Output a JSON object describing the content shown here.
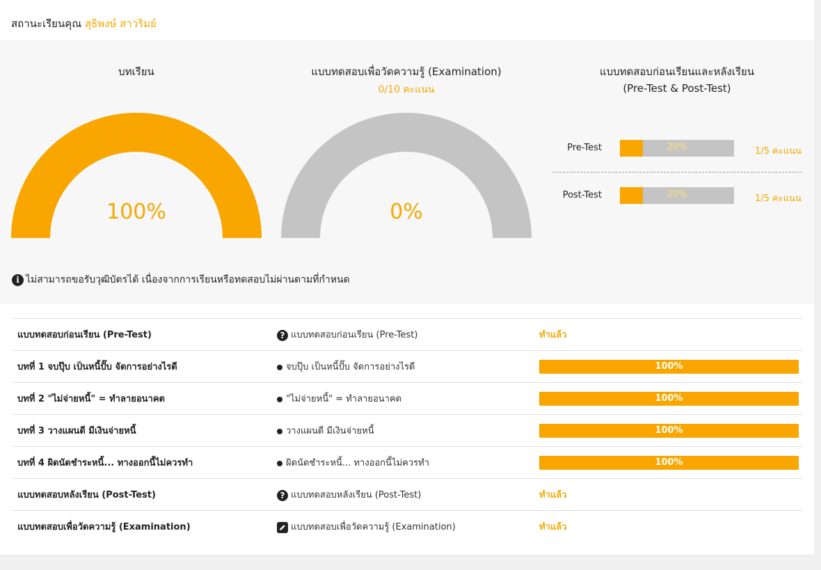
{
  "header": {
    "prefix": "สถานะเรียนคุณ",
    "name": "สุธิพงษ์ สาวริมย์"
  },
  "summary": {
    "lessons": {
      "title": "บทเรียน",
      "percent_label": "100%",
      "percent": 100
    },
    "exam": {
      "title": "แบบทดสอบเพื่อวัดความรู้ (Examination)",
      "score": "0/10 คะแนน",
      "percent_label": "0%",
      "percent": 0
    },
    "prepost": {
      "title_line1": "แบบทดสอบก่อนเรียนและหลังเรียน",
      "title_line2": "(Pre-Test & Post-Test)",
      "pre": {
        "label": "Pre-Test",
        "bar_label": "20%",
        "percent": 20,
        "score": "1/5 คะแนน"
      },
      "post": {
        "label": "Post-Test",
        "bar_label": "20%",
        "percent": 20,
        "score": "1/5 คะแนน"
      }
    },
    "notice": "ไม่สามารถขอรับวุฒิบัตรได้ เนื่องจากการเรียนหรือทดสอบไม่ผ่านตามที่กำหนด"
  },
  "colors": {
    "accent": "#f9a600",
    "gauge_empty": "#c4c4c4"
  },
  "rows": [
    {
      "title": "แบบทดสอบก่อนเรียน (Pre-Test)",
      "item_icon": "question-circle-icon",
      "item": "แบบทดสอบก่อนเรียน (Pre-Test)",
      "status": "ทำแล้ว"
    },
    {
      "title": "บทที่ 1 จบปุ๊บ เป็นหนี้ปั๊บ จัดการอย่างไรดี",
      "item_icon": "bullet-icon",
      "item": "จบปุ๊บ เป็นหนี้ปั๊บ จัดการอย่างไรดี",
      "progress": "100%"
    },
    {
      "title": "บทที่ 2 \"ไม่จ่ายหนี้\" = ทำลายอนาคต",
      "item_icon": "bullet-icon",
      "item": "\"ไม่จ่ายหนี้\" = ทำลายอนาคต",
      "progress": "100%"
    },
    {
      "title": "บทที่ 3 วางแผนดี มีเงินจ่ายหนี้",
      "item_icon": "bullet-icon",
      "item": "วางแผนดี มีเงินจ่ายหนี้",
      "progress": "100%"
    },
    {
      "title": "บทที่ 4 ผิดนัดชำระหนี้... ทางออกนี้ไม่ควรทำ",
      "item_icon": "bullet-icon",
      "item": "ผิดนัดชำระหนี้... ทางออกนี้ไม่ควรทำ",
      "progress": "100%"
    },
    {
      "title": "แบบทดสอบหลังเรียน (Post-Test)",
      "item_icon": "question-circle-icon",
      "item": "แบบทดสอบหลังเรียน (Post-Test)",
      "status": "ทำแล้ว"
    },
    {
      "title": "แบบทดสอบเพื่อวัดความรู้ (Examination)",
      "item_icon": "edit-icon",
      "item": "แบบทดสอบเพื่อวัดความรู้ (Examination)",
      "status": "ทำแล้ว"
    }
  ]
}
